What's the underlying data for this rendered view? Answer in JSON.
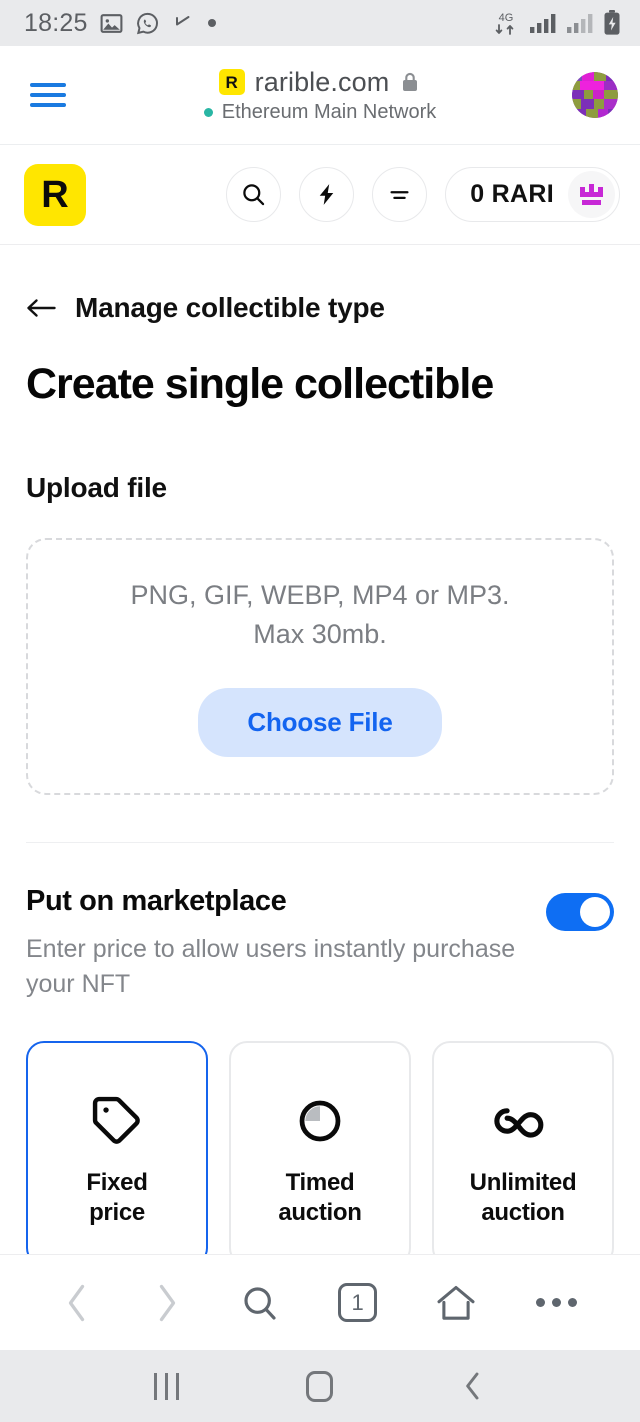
{
  "status_bar": {
    "time": "18:25",
    "left_icons": [
      "gallery-icon",
      "whatsapp-icon",
      "reply-arrow-icon",
      "dot-icon"
    ],
    "network_label": "4G",
    "right_icons": [
      "4g-data-icon",
      "signal-bars-icon",
      "signal-bars-2-icon",
      "battery-charging-icon"
    ]
  },
  "browser": {
    "menu_icon": "hamburger-menu-icon",
    "favicon_letter": "R",
    "url": "rarible.com",
    "lock_icon": "lock-icon",
    "network": "Ethereum Main Network",
    "avatar": "account-avatar"
  },
  "app_header": {
    "logo_letter": "R",
    "buttons": [
      {
        "name": "search-icon",
        "label": "Search"
      },
      {
        "name": "lightning-icon",
        "label": "Activity"
      },
      {
        "name": "filter-lines-icon",
        "label": "Menu"
      }
    ],
    "balance": "0 RARI",
    "badge_icon": "rari-crown-icon"
  },
  "page": {
    "back_label": "Manage collectible type",
    "back_icon": "arrow-left-icon",
    "title": "Create single collectible"
  },
  "upload": {
    "heading": "Upload file",
    "formats": "PNG, GIF, WEBP, MP4 or MP3.",
    "max_size": "Max 30mb.",
    "button_label": "Choose File"
  },
  "marketplace": {
    "title": "Put on marketplace",
    "subtitle": "Enter price to allow users instantly purchase your NFT",
    "toggle_on": true,
    "options": [
      {
        "icon": "price-tag-icon",
        "line1": "Fixed",
        "line2": "price",
        "selected": true
      },
      {
        "icon": "timer-clock-icon",
        "line1": "Timed",
        "line2": "auction",
        "selected": false
      },
      {
        "icon": "infinity-icon",
        "line1": "Unlimited",
        "line2": "auction",
        "selected": false
      }
    ]
  },
  "bottom_toolbar": {
    "back_icon": "chevron-left-icon",
    "forward_icon": "chevron-right-icon",
    "search_icon": "search-icon",
    "tab_count": "1",
    "home_icon": "home-icon",
    "more_icon": "more-options-icon"
  },
  "nav_bar": {
    "recents_icon": "recents-icon",
    "home_icon": "home-square-icon",
    "back_icon": "back-chevron-icon"
  },
  "colors": {
    "accent_blue": "#0e6ef3",
    "rarible_yellow": "#FFE600",
    "selected_border": "#1564ed",
    "choose_file_bg": "#d5e4fd",
    "network_dot": "#29b6a4"
  }
}
